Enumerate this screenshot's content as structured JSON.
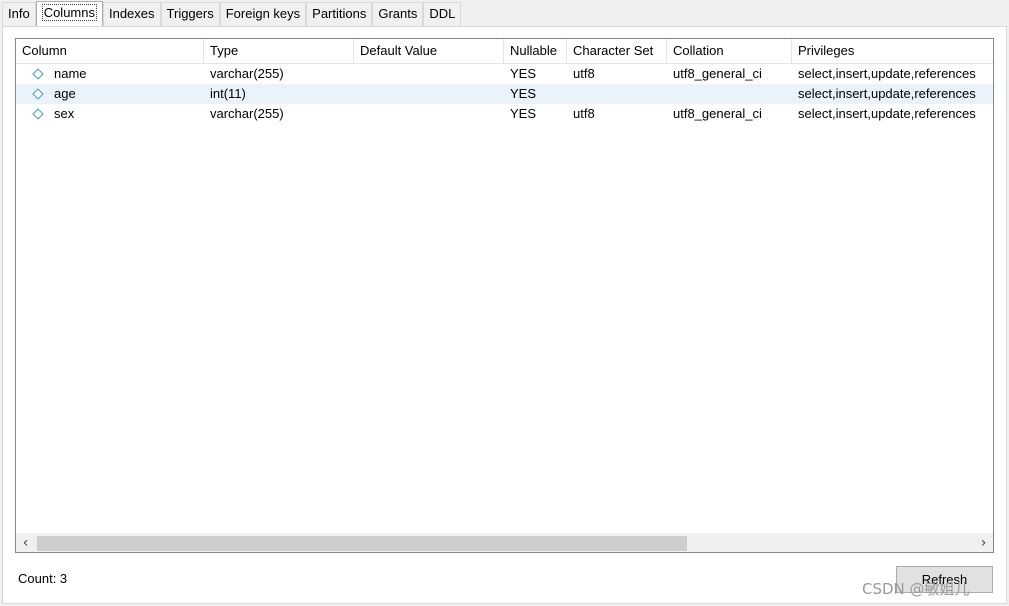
{
  "tabs": [
    {
      "label": "Info",
      "active": false
    },
    {
      "label": "Columns",
      "active": true
    },
    {
      "label": "Indexes",
      "active": false
    },
    {
      "label": "Triggers",
      "active": false
    },
    {
      "label": "Foreign keys",
      "active": false
    },
    {
      "label": "Partitions",
      "active": false
    },
    {
      "label": "Grants",
      "active": false
    },
    {
      "label": "DDL",
      "active": false
    }
  ],
  "grid": {
    "headers": [
      "Column",
      "Type",
      "Default Value",
      "Nullable",
      "Character Set",
      "Collation",
      "Privileges"
    ],
    "rows": [
      {
        "icon": "column-diamond-icon",
        "column": "name",
        "type": "varchar(255)",
        "default": "",
        "nullable": "YES",
        "charset": "utf8",
        "collation": "utf8_general_ci",
        "privileges": "select,insert,update,references",
        "selected": false
      },
      {
        "icon": "column-diamond-icon",
        "column": "age",
        "type": "int(11)",
        "default": "",
        "nullable": "YES",
        "charset": "",
        "collation": "",
        "privileges": "select,insert,update,references",
        "selected": true
      },
      {
        "icon": "column-diamond-icon",
        "column": "sex",
        "type": "varchar(255)",
        "default": "",
        "nullable": "YES",
        "charset": "utf8",
        "collation": "utf8_general_ci",
        "privileges": "select,insert,update,references",
        "selected": false
      }
    ]
  },
  "scrollbar": {
    "left_arrow": "‹",
    "right_arrow": "›"
  },
  "footer": {
    "count": "Count: 3",
    "refresh_label": "Refresh"
  },
  "watermark": "CSDN @敏姐儿",
  "colors": {
    "selected_row": "#eaf2fb",
    "icon_blue": "#3f97c0"
  }
}
